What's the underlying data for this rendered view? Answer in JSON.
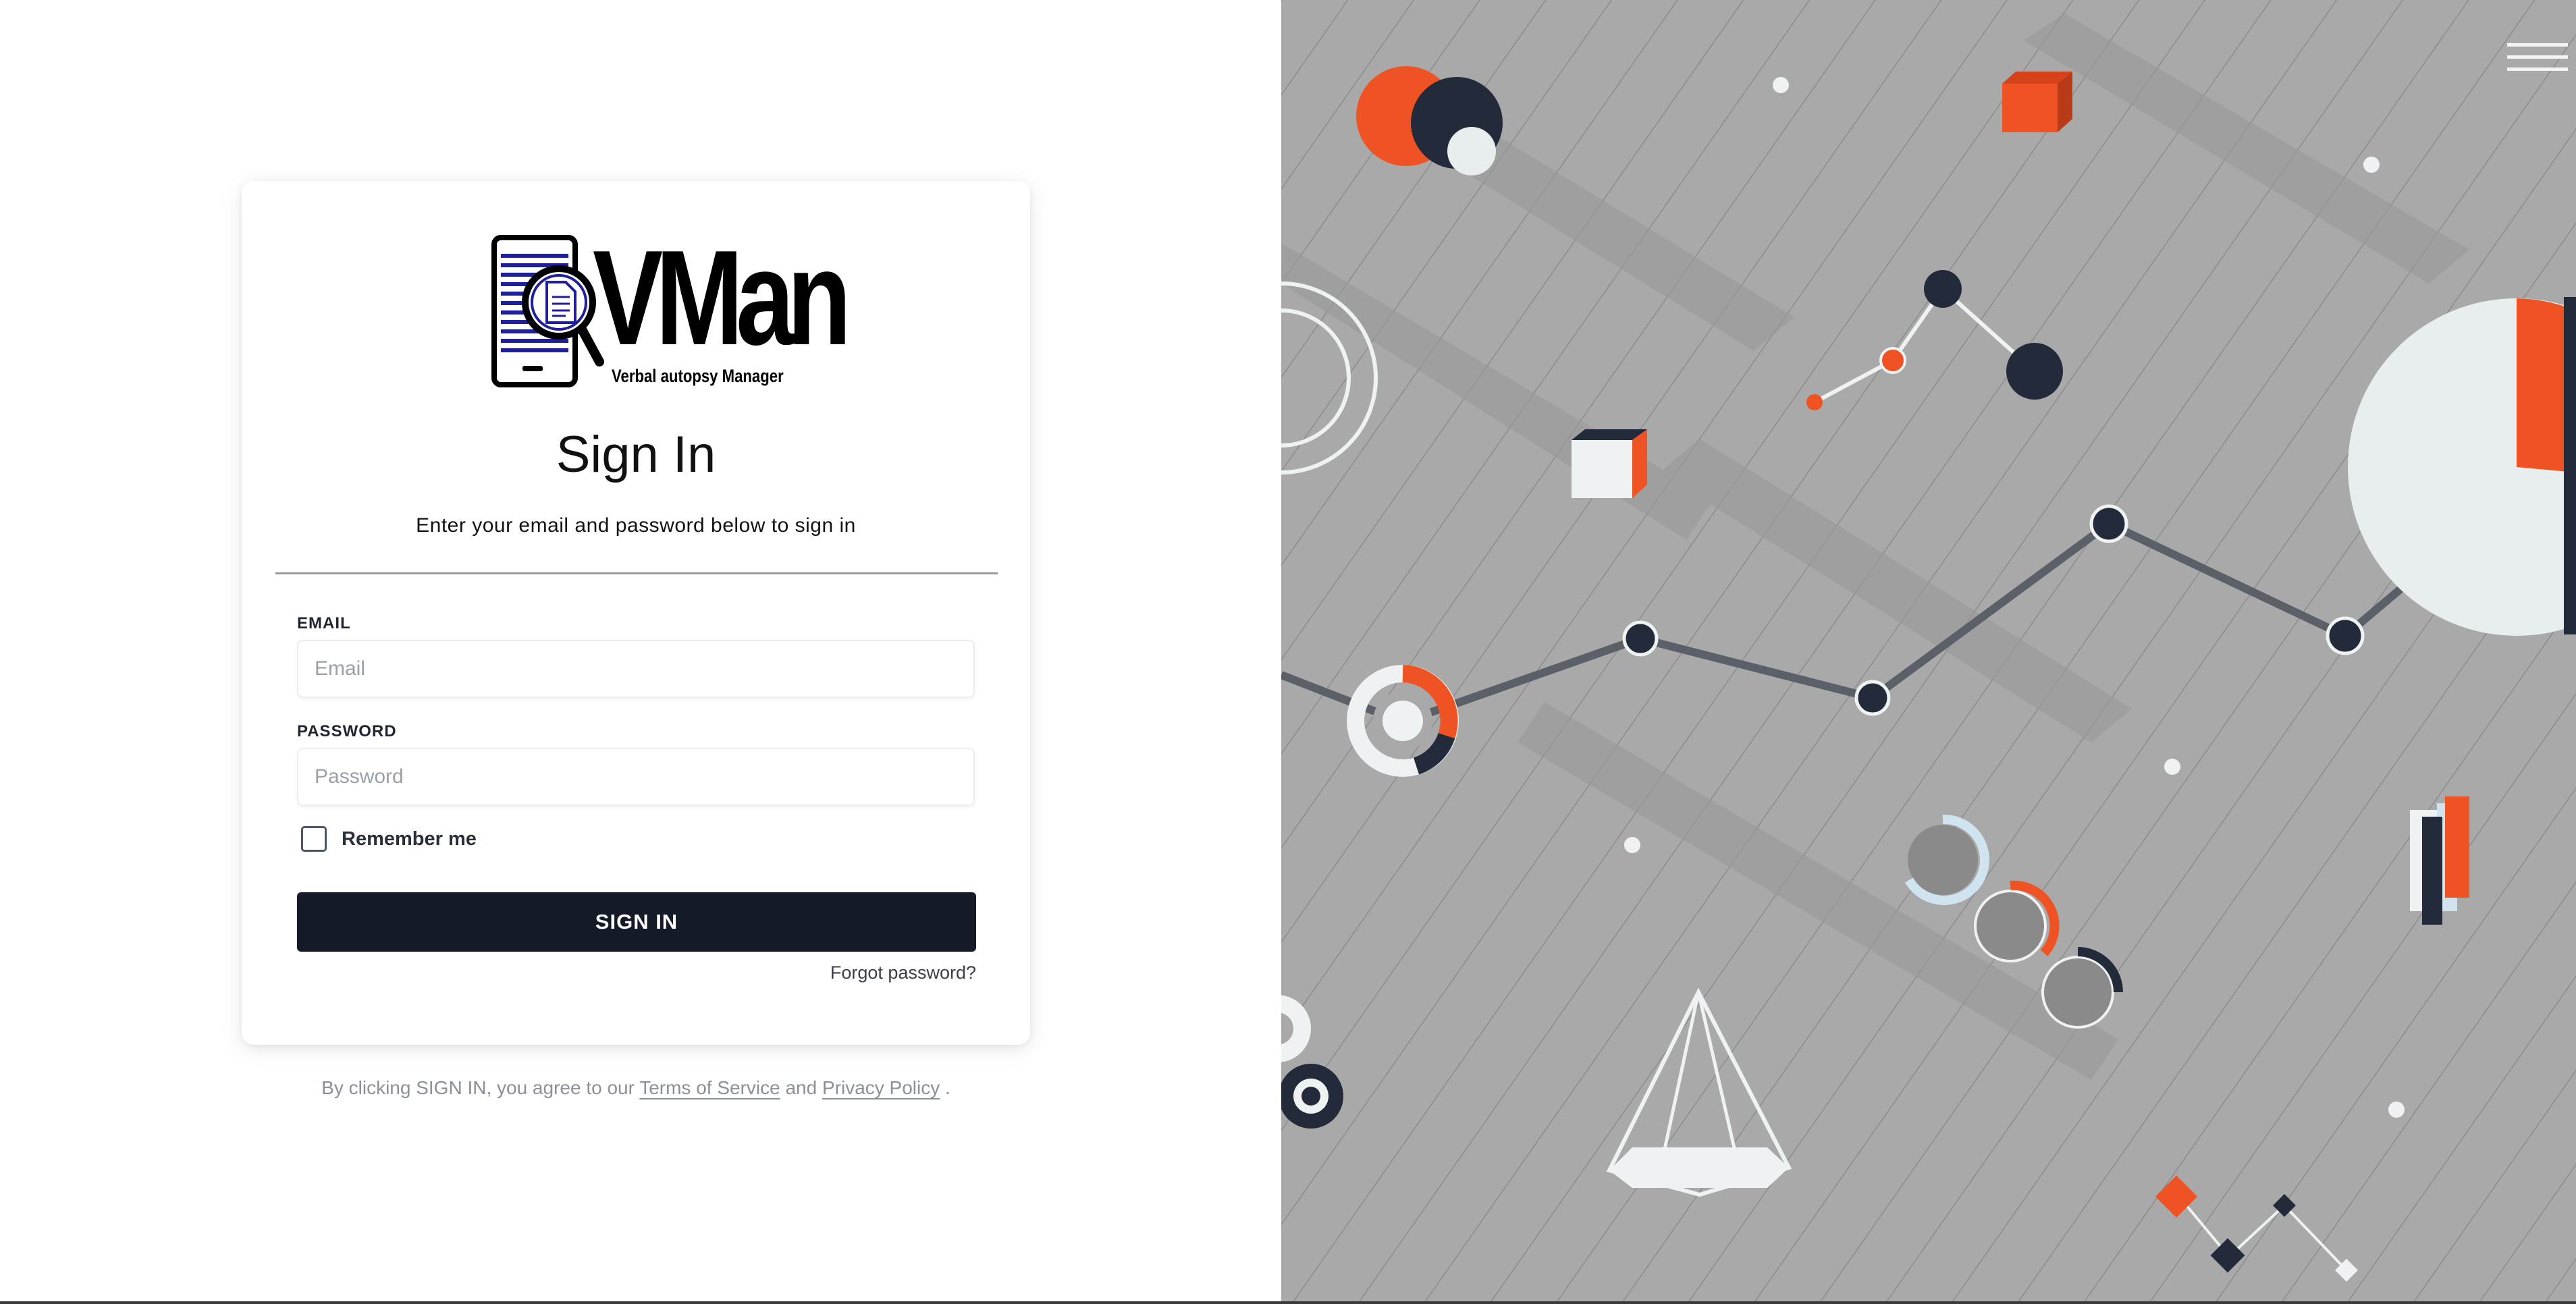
{
  "app": {
    "name": "VMan",
    "tagline": "Verbal autopsy Manager"
  },
  "signin": {
    "title": "Sign In",
    "subtitle": "Enter your email and password below to sign in",
    "email_label": "EMAIL",
    "email_placeholder": "Email",
    "email_value": "",
    "password_label": "PASSWORD",
    "password_placeholder": "Password",
    "password_value": "",
    "remember_label": "Remember me",
    "remember_checked": false,
    "submit_label": "SIGN IN",
    "forgot_label": "Forgot password?"
  },
  "legal": {
    "prefix": "By clicking SIGN IN, you agree to our",
    "terms_label": "Terms of Service",
    "and": "and",
    "privacy_label": "Privacy Policy",
    "suffix": "."
  },
  "icons": {
    "logo": "vman-logo",
    "menu": "menu-icon",
    "illustration": "abstract-chart-illustration"
  },
  "colors": {
    "accent_dark": "#141a27",
    "accent_orange": "#f05323",
    "background_gray": "#a9a9a9"
  }
}
